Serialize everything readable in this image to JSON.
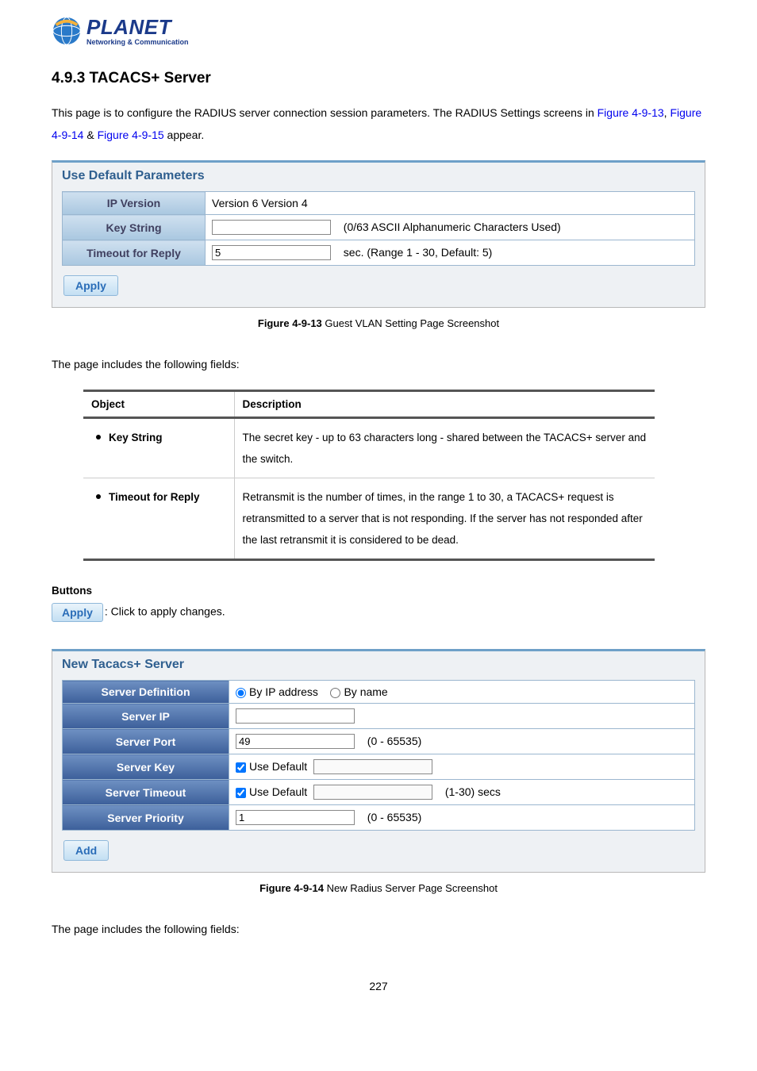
{
  "logo": {
    "word": "PLANET",
    "tagline": "Networking & Communication"
  },
  "section_heading": "4.9.3 TACACS+ Server",
  "intro": {
    "pre": "This page is to configure the RADIUS server connection session parameters. The RADIUS Settings screens in ",
    "link1": "Figure 4-9-13",
    "mid1": ", ",
    "link2": "Figure 4-9-14",
    "mid2": " & ",
    "link3": "Figure 4-9-15",
    "post": " appear."
  },
  "panel1": {
    "title": "Use Default Parameters",
    "rows": {
      "ip_version": {
        "label": "IP Version",
        "value": "Version 6 Version 4"
      },
      "key_string": {
        "label": "Key String",
        "hint": "(0/63 ASCII Alphanumeric Characters Used)"
      },
      "timeout": {
        "label": "Timeout for Reply",
        "value": "5",
        "hint": "sec. (Range 1 - 30, Default: 5)"
      }
    },
    "apply": "Apply"
  },
  "caption1": {
    "bold": "Figure 4-9-13",
    "rest": " Guest VLAN Setting Page Screenshot"
  },
  "fields_intro": "The page includes the following fields:",
  "desc_table": {
    "headers": {
      "object": "Object",
      "description": "Description"
    },
    "rows": [
      {
        "object": "Key String",
        "description": "The secret key - up to 63 characters long - shared between the TACACS+ server and the switch."
      },
      {
        "object": "Timeout for Reply",
        "description": "Retransmit is the number of times, in the range 1 to 30, a TACACS+ request is retransmitted to a server that is not responding. If the server has not responded after the last retransmit it is considered to be dead."
      }
    ]
  },
  "buttons": {
    "heading": "Buttons",
    "apply": "Apply",
    "text": ": Click to apply changes."
  },
  "panel2": {
    "title": "New Tacacs+ Server",
    "rows": {
      "definition": {
        "label": "Server Definition",
        "opt1": "By IP address",
        "opt2": "By name"
      },
      "ip": {
        "label": "Server IP"
      },
      "port": {
        "label": "Server Port",
        "value": "49",
        "hint": "(0 - 65535)"
      },
      "key": {
        "label": "Server Key",
        "chk": "Use Default"
      },
      "timeout": {
        "label": "Server Timeout",
        "chk": "Use Default",
        "hint": "(1-30) secs"
      },
      "priority": {
        "label": "Server Priority",
        "value": "1",
        "hint": "(0 - 65535)"
      }
    },
    "add": "Add"
  },
  "caption2": {
    "bold": "Figure 4-9-14",
    "rest": " New Radius Server Page Screenshot"
  },
  "fields_intro2": "The page includes the following fields:",
  "page_number": "227"
}
